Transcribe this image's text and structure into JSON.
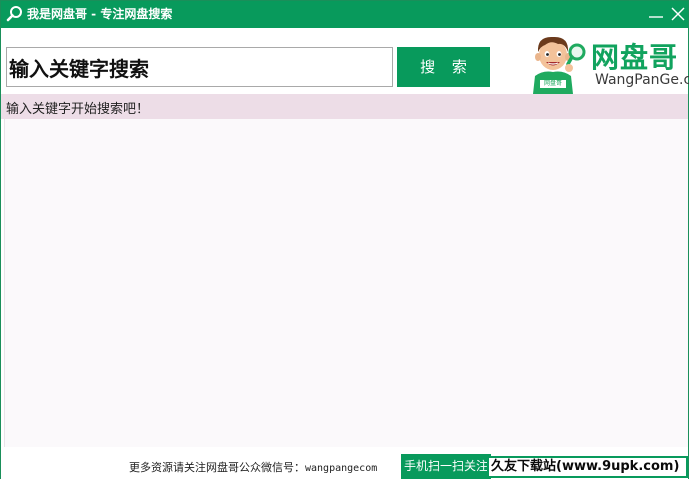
{
  "window": {
    "title": "我是网盘哥 - 专注网盘搜索"
  },
  "search": {
    "value": "输入关键字搜索",
    "button_label": "搜 索"
  },
  "logo": {
    "brand_cn": "网盘哥",
    "brand_en": "WangPanGe.com",
    "mascot_badge": "网盘哥"
  },
  "hint": {
    "text": "输入关键字开始搜索吧！"
  },
  "footer": {
    "wechat_label": "更多资源请关注网盘哥公众微信号：",
    "wechat_id": "wangpangecom",
    "scan_button_label": "手机扫一扫关注",
    "watermark_text": "久友下载站(www.9upk.com)"
  },
  "colors": {
    "accent": "#089a5c",
    "hint_bg": "#eddde7",
    "results_bg": "#fbf9fb"
  },
  "icons": {
    "app": "magnifier-icon",
    "minimize": "minimize-icon",
    "close": "close-icon"
  }
}
